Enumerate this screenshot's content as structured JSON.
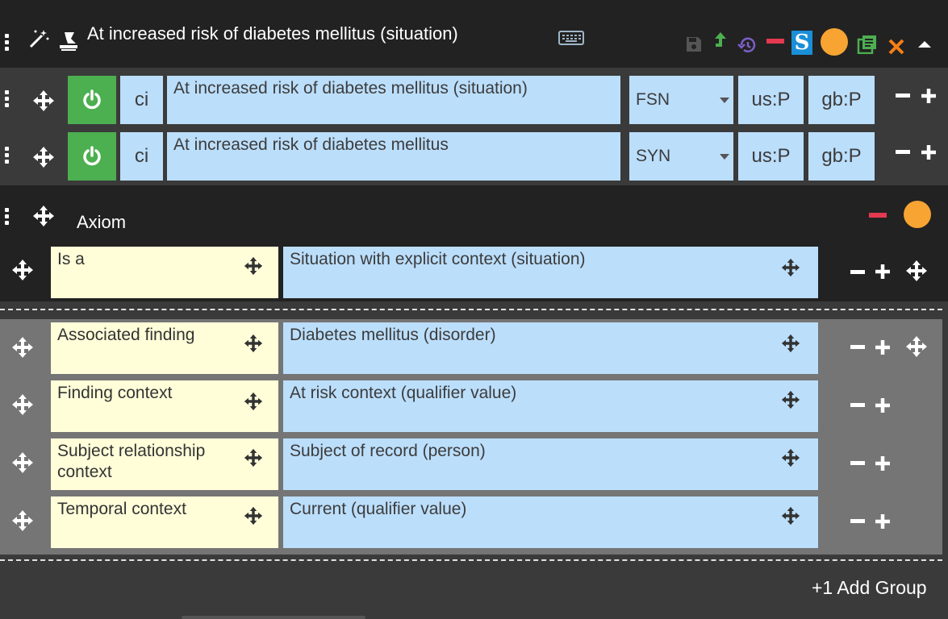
{
  "header": {
    "title": "At increased risk of diabetes mellitus (situation)",
    "icons": [
      "menu-dots-icon",
      "magic-wand-icon",
      "stamp-icon",
      "keyboard-icon",
      "save-icon",
      "promote-arrow-icon",
      "history-icon",
      "remove-icon",
      "s-badge-icon",
      "status-circle-icon",
      "copy-icon",
      "close-icon",
      "collapse-caret-icon"
    ],
    "s_badge": "S",
    "colors": {
      "bg": "#222222",
      "green": "#4caf50",
      "red": "#e53950",
      "orange": "#f7a433",
      "blue_badge": "#1a8fd8",
      "purple": "#7b5fc7"
    }
  },
  "descriptions": [
    {
      "case": "ci",
      "term": "At increased risk of diabetes mellitus (situation)",
      "type": "FSN",
      "us": "us:P",
      "gb": "gb:P"
    },
    {
      "case": "ci",
      "term": "At increased risk of diabetes mellitus",
      "type": "SYN",
      "us": "us:P",
      "gb": "gb:P"
    }
  ],
  "axiom": {
    "title": "Axiom",
    "is_a": {
      "attribute": "Is a",
      "value": "Situation with explicit context (situation)"
    },
    "group": [
      {
        "attribute": "Associated finding",
        "value": "Diabetes mellitus (disorder)"
      },
      {
        "attribute": "Finding context",
        "value": "At risk context (qualifier value)"
      },
      {
        "attribute": "Subject relationship context",
        "value": "Subject of record (person)"
      },
      {
        "attribute": "Temporal context",
        "value": "Current (qualifier value)"
      }
    ]
  },
  "footer": {
    "add_group": "+1 Add Group"
  },
  "controls": {
    "minus": "−",
    "plus": "+"
  }
}
